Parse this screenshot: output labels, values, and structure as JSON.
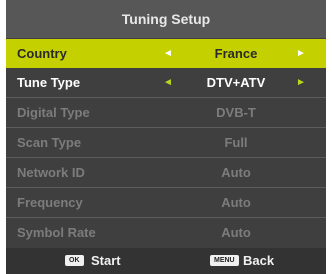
{
  "title": "Tuning Setup",
  "rows": [
    {
      "label": "Country",
      "value": "France",
      "left_arrow": "◄",
      "right_arrow": "►"
    },
    {
      "label": "Tune Type",
      "value": "DTV+ATV",
      "left_arrow": "◄",
      "right_arrow": "►"
    },
    {
      "label": "Digital Type",
      "value": "DVB-T"
    },
    {
      "label": "Scan Type",
      "value": "Full"
    },
    {
      "label": "Network ID",
      "value": "Auto"
    },
    {
      "label": "Frequency",
      "value": "Auto"
    },
    {
      "label": "Symbol Rate",
      "value": "Auto"
    }
  ],
  "footer": {
    "ok_key": "OK",
    "ok_label": "Start",
    "menu_key": "MENU",
    "menu_label": "Back"
  },
  "colors": {
    "highlight": "#c4d000",
    "arrow_active": "#b9d81c",
    "disabled_text": "#7c7c7c"
  }
}
